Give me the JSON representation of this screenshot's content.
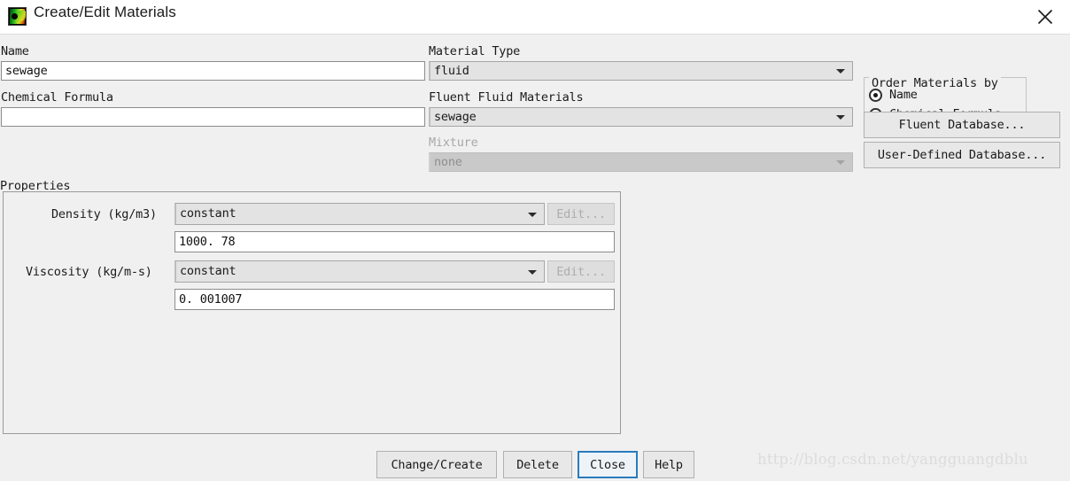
{
  "window": {
    "title": "Create/Edit Materials",
    "icon": "fluent-app-icon",
    "close_icon": "close-icon"
  },
  "form": {
    "name_label": "Name",
    "name_value": "sewage",
    "chemical_formula_label": "Chemical Formula",
    "chemical_formula_value": "",
    "material_type_label": "Material Type",
    "material_type_value": "fluid",
    "fluent_fluid_materials_label": "Fluent Fluid Materials",
    "fluent_fluid_materials_value": "sewage",
    "mixture_label": "Mixture",
    "mixture_value": "none"
  },
  "order_by": {
    "group_title": "Order Materials by",
    "options": [
      {
        "label": "Name",
        "selected": true
      },
      {
        "label": "Chemical Formula",
        "selected": false
      }
    ]
  },
  "database_buttons": {
    "fluent_database": "Fluent Database...",
    "user_defined_database": "User-Defined Database..."
  },
  "properties": {
    "title": "Properties",
    "rows": [
      {
        "label": "Density (kg/m3)",
        "method": "constant",
        "edit_label": "Edit...",
        "value": "1000. 78"
      },
      {
        "label": "Viscosity (kg/m-s)",
        "method": "constant",
        "edit_label": "Edit...",
        "value": "0. 001007"
      }
    ]
  },
  "footer": {
    "buttons": [
      {
        "label": "Change/Create",
        "focused": false
      },
      {
        "label": "Delete",
        "focused": false
      },
      {
        "label": "Close",
        "focused": true
      },
      {
        "label": "Help",
        "focused": false
      }
    ],
    "watermark": "http://blog.csdn.net/yangguangdblu"
  },
  "colors": {
    "dialog_background": "#f0f0f0",
    "titlebar_background": "#ffffff",
    "field_background": "#ffffff",
    "combo_background": "#e3e3e3",
    "disabled_combo_background": "#c9c9c9",
    "focus_outline": "#2a7bbd",
    "watermark_text": "#dcdcdc"
  }
}
